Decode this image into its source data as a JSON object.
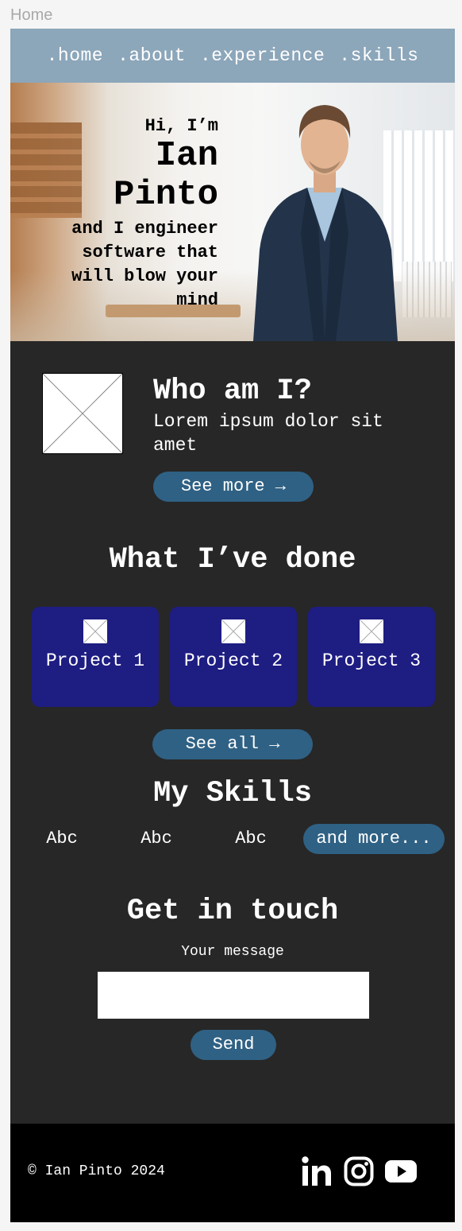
{
  "frame_label": "Home",
  "nav": {
    "items": [
      ".home",
      ".about",
      ".experience",
      ".skills"
    ]
  },
  "hero": {
    "greeting": "Hi, I’m",
    "name_line1": "Ian",
    "name_line2": "Pinto",
    "tagline": "and I engineer software that will blow your mind"
  },
  "about": {
    "title": "Who am I?",
    "text": "Lorem ipsum dolor sit amet",
    "button": "See more →"
  },
  "done": {
    "title": "What I’ve done",
    "projects": [
      "Project 1",
      "Project 2",
      "Project 3"
    ],
    "button": "See all →"
  },
  "skills": {
    "title": "My Skills",
    "items": [
      "Abc",
      "Abc",
      "Abc"
    ],
    "more": "and more..."
  },
  "contact": {
    "title": "Get in touch",
    "message_label": "Your message",
    "message_value": "",
    "send": "Send"
  },
  "footer": {
    "copyright": "© Ian Pinto 2024",
    "social_icons": [
      "linkedin-icon",
      "instagram-icon",
      "youtube-icon"
    ]
  },
  "colors": {
    "page_bg": "#272727",
    "nav_bg": "#8ca6ba",
    "button": "#2f6184",
    "project_card": "#1e1d82",
    "footer_bg": "#000000"
  }
}
